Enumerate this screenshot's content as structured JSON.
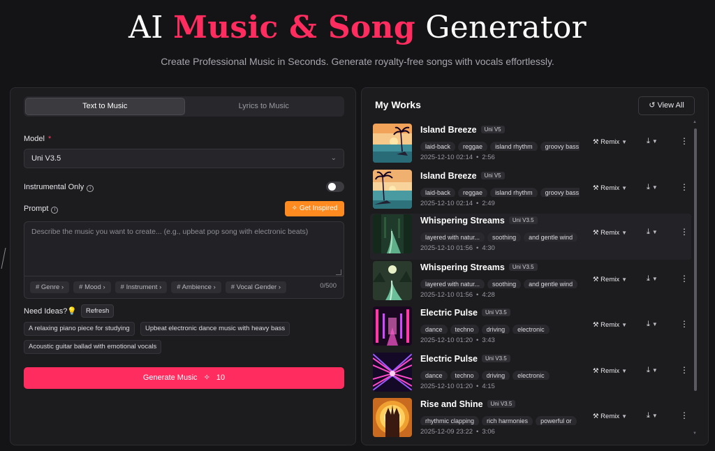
{
  "hero": {
    "title_pre": "AI ",
    "title_accent": "Music & Song",
    "title_post": " Generator",
    "subtitle": "Create Professional Music in Seconds. Generate royalty-free songs with vocals effortlessly."
  },
  "left": {
    "tabs": [
      "Text to Music",
      "Lyrics to Music"
    ],
    "model_label": "Model",
    "model_required": "*",
    "model_value": "Uni V3.5",
    "instrumental_label": "Instrumental Only",
    "instrumental_on": false,
    "prompt_label": "Prompt",
    "get_inspired": "Get Inspired",
    "prompt_placeholder": "Describe the music you want to create... (e.g., upbeat pop song with electronic beats)",
    "tag_buttons": [
      "# Genre",
      "# Mood",
      "# Instrument",
      "# Ambience",
      "# Vocal Gender"
    ],
    "counter": "0/500",
    "need_ideas": "Need Ideas?",
    "refresh": "Refresh",
    "ideas": [
      "A relaxing piano piece for studying",
      "Upbeat electronic dance music with heavy bass",
      "Acoustic guitar ballad with emotional vocals"
    ],
    "generate_label": "Generate Music",
    "generate_cost": "10"
  },
  "right": {
    "title": "My Works",
    "view_all": "View All",
    "remix_label": "Remix",
    "works": [
      {
        "title": "Island Breeze",
        "version": "Uni V5",
        "tags": [
          "laid-back",
          "reggae",
          "island rhythm",
          "groovy bass"
        ],
        "date": "2025-12-10 02:14",
        "duration": "2:56"
      },
      {
        "title": "Island Breeze",
        "version": "Uni V5",
        "tags": [
          "laid-back",
          "reggae",
          "island rhythm",
          "groovy bass"
        ],
        "date": "2025-12-10 02:14",
        "duration": "2:49"
      },
      {
        "title": "Whispering Streams",
        "version": "Uni V3.5",
        "tags": [
          "layered with natur...",
          "soothing",
          "and gentle wind"
        ],
        "date": "2025-12-10 01:56",
        "duration": "4:30"
      },
      {
        "title": "Whispering Streams",
        "version": "Uni V3.5",
        "tags": [
          "layered with natur...",
          "soothing",
          "and gentle wind"
        ],
        "date": "2025-12-10 01:56",
        "duration": "4:28"
      },
      {
        "title": "Electric Pulse",
        "version": "Uni V3.5",
        "tags": [
          "dance",
          "techno",
          "driving",
          "electronic"
        ],
        "date": "2025-12-10 01:20",
        "duration": "3:43"
      },
      {
        "title": "Electric Pulse",
        "version": "Uni V3.5",
        "tags": [
          "dance",
          "techno",
          "driving",
          "electronic"
        ],
        "date": "2025-12-10 01:20",
        "duration": "4:15"
      },
      {
        "title": "Rise and Shine",
        "version": "Uni V3.5",
        "tags": [
          "rhythmic clapping",
          "rich harmonies",
          "powerful or"
        ],
        "date": "2025-12-09 23:22",
        "duration": "3:06"
      }
    ]
  }
}
